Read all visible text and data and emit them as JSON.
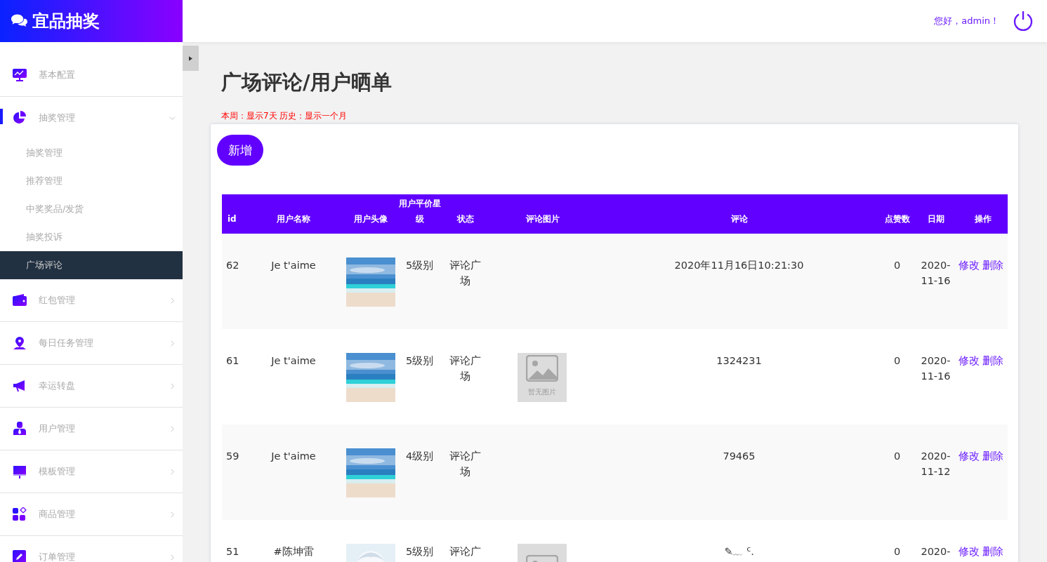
{
  "brand": {
    "title": "宜品抽奖"
  },
  "header": {
    "greeting": "您好，admin！"
  },
  "sidebar": {
    "items": [
      {
        "label": "基本配置",
        "expandable": false,
        "expanded": false
      },
      {
        "label": "抽奖管理",
        "expandable": true,
        "expanded": true,
        "children": [
          {
            "label": "抽奖管理",
            "selected": false
          },
          {
            "label": "推荐管理",
            "selected": false
          },
          {
            "label": "中奖奖品/发货",
            "selected": false
          },
          {
            "label": "抽奖投诉",
            "selected": false
          },
          {
            "label": "广场评论",
            "selected": true
          }
        ]
      },
      {
        "label": "红包管理",
        "expandable": true,
        "expanded": false
      },
      {
        "label": "每日任务管理",
        "expandable": true,
        "expanded": false
      },
      {
        "label": "幸运转盘",
        "expandable": true,
        "expanded": false
      },
      {
        "label": "用户管理",
        "expandable": true,
        "expanded": false
      },
      {
        "label": "模板管理",
        "expandable": true,
        "expanded": false
      },
      {
        "label": "商品管理",
        "expandable": true,
        "expanded": false
      },
      {
        "label": "订单管理",
        "expandable": true,
        "expanded": false
      }
    ]
  },
  "page": {
    "title": "广场评论/用户晒单",
    "note": "本周：显示7天 历史：显示一个月",
    "add_button": "新增"
  },
  "table": {
    "columns": [
      "id",
      "用户名称",
      "用户头像",
      "用户平价星级",
      "状态",
      "评论图片",
      "评论",
      "点赞数",
      "日期",
      "操作"
    ],
    "rows": [
      {
        "id": "62",
        "name": "Je t'aime",
        "stars": "5级别",
        "status": "评论广场",
        "image": {
          "kind": "none"
        },
        "comment": "2020年11月16日10:21:30",
        "likes": "0",
        "date": "2020-11-16",
        "actions": [
          "修改",
          "删除"
        ]
      },
      {
        "id": "61",
        "name": "Je t'aime",
        "stars": "5级别",
        "status": "评论广场",
        "image": {
          "kind": "placeholder",
          "label": "暂无图片"
        },
        "comment": "1324231",
        "likes": "0",
        "date": "2020-11-16",
        "actions": [
          "修改",
          "删除"
        ]
      },
      {
        "id": "59",
        "name": "Je t'aime",
        "stars": "4级别",
        "status": "评论广场",
        "image": {
          "kind": "none"
        },
        "comment": "79465",
        "likes": "0",
        "date": "2020-11-12",
        "actions": [
          "修改",
          "删除"
        ]
      },
      {
        "id": "51",
        "name": "#陈坤雷",
        "stars": "5级别",
        "status": "评论广",
        "image": {
          "kind": "placeholder"
        },
        "comment": "✎﹏ ᑦ.",
        "likes": "0",
        "date": "2020-",
        "actions": [
          "修改",
          "删除"
        ]
      }
    ]
  }
}
